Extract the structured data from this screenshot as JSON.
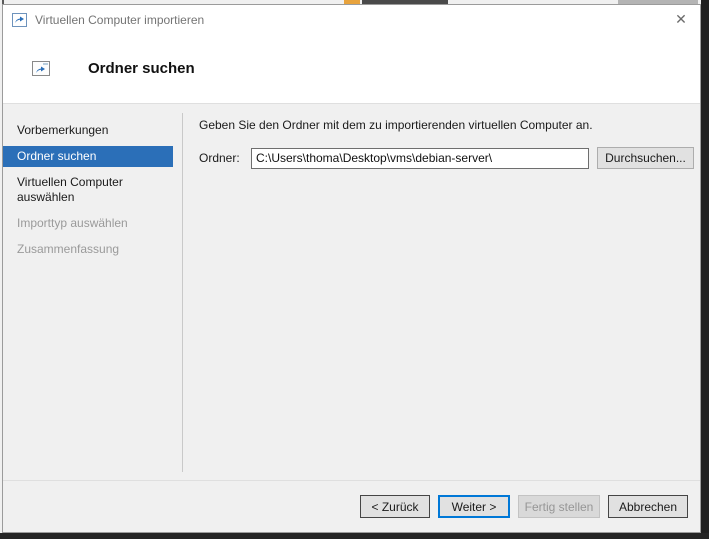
{
  "window": {
    "title": "Virtuellen Computer importieren",
    "close_glyph": "✕"
  },
  "header": {
    "title": "Ordner suchen"
  },
  "sidebar": {
    "items": [
      {
        "label": "Vorbemerkungen",
        "state": "enabled"
      },
      {
        "label": "Ordner suchen",
        "state": "selected"
      },
      {
        "label": "Virtuellen Computer auswählen",
        "state": "enabled"
      },
      {
        "label": "Importtyp auswählen",
        "state": "disabled"
      },
      {
        "label": "Zusammenfassung",
        "state": "disabled"
      }
    ]
  },
  "main": {
    "instruction": "Geben Sie den Ordner mit dem zu importierenden virtuellen Computer an.",
    "folder_label": "Ordner:",
    "folder_value": "C:\\Users\\thoma\\Desktop\\vms\\debian-server\\",
    "browse_button": "Durchsuchen..."
  },
  "footer": {
    "buttons": [
      {
        "label": "< Zurück",
        "state": "enabled"
      },
      {
        "label": "Weiter >",
        "state": "default-focused"
      },
      {
        "label": "Fertig stellen",
        "state": "disabled"
      },
      {
        "label": "Abbrechen",
        "state": "enabled"
      }
    ]
  },
  "colors": {
    "selection_blue": "#2b6fb8",
    "accent_blue": "#0078d7",
    "dialog_bg": "#f0f0f0",
    "header_bg": "#ffffff"
  }
}
